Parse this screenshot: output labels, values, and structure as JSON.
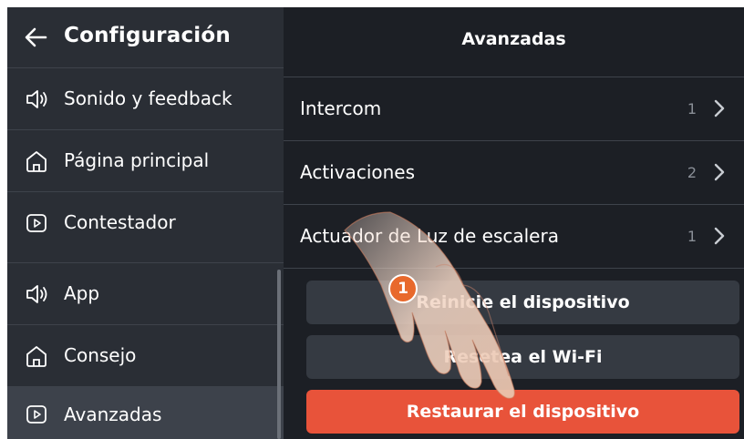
{
  "sidebar": {
    "title": "Configuración",
    "items": [
      {
        "label": "Sonido y feedback",
        "icon": "speaker-icon"
      },
      {
        "label": "Página principal",
        "icon": "home-icon"
      },
      {
        "label": "Contestador",
        "icon": "play-box-icon"
      },
      {
        "label": "App",
        "icon": "speaker-icon"
      },
      {
        "label": "Consejo",
        "icon": "home-icon"
      },
      {
        "label": "Avanzadas",
        "icon": "play-box-icon",
        "active": true
      }
    ]
  },
  "main": {
    "title": "Avanzadas",
    "rows": [
      {
        "label": "Intercom",
        "count": "1"
      },
      {
        "label": "Activaciones",
        "count": "2"
      },
      {
        "label": "Actuador de Luz de escalera",
        "count": "1"
      }
    ],
    "buttons": {
      "restart_device": "Reinicie el dispositivo",
      "reset_wifi": "Resetea el Wi-Fi",
      "restore_device": "Restaurar el dispositivo"
    }
  },
  "overlay": {
    "step_number": "1"
  },
  "colors": {
    "accent": "#e8533a",
    "sidebar_bg": "#2a2e35",
    "main_bg": "#1c1f25"
  }
}
